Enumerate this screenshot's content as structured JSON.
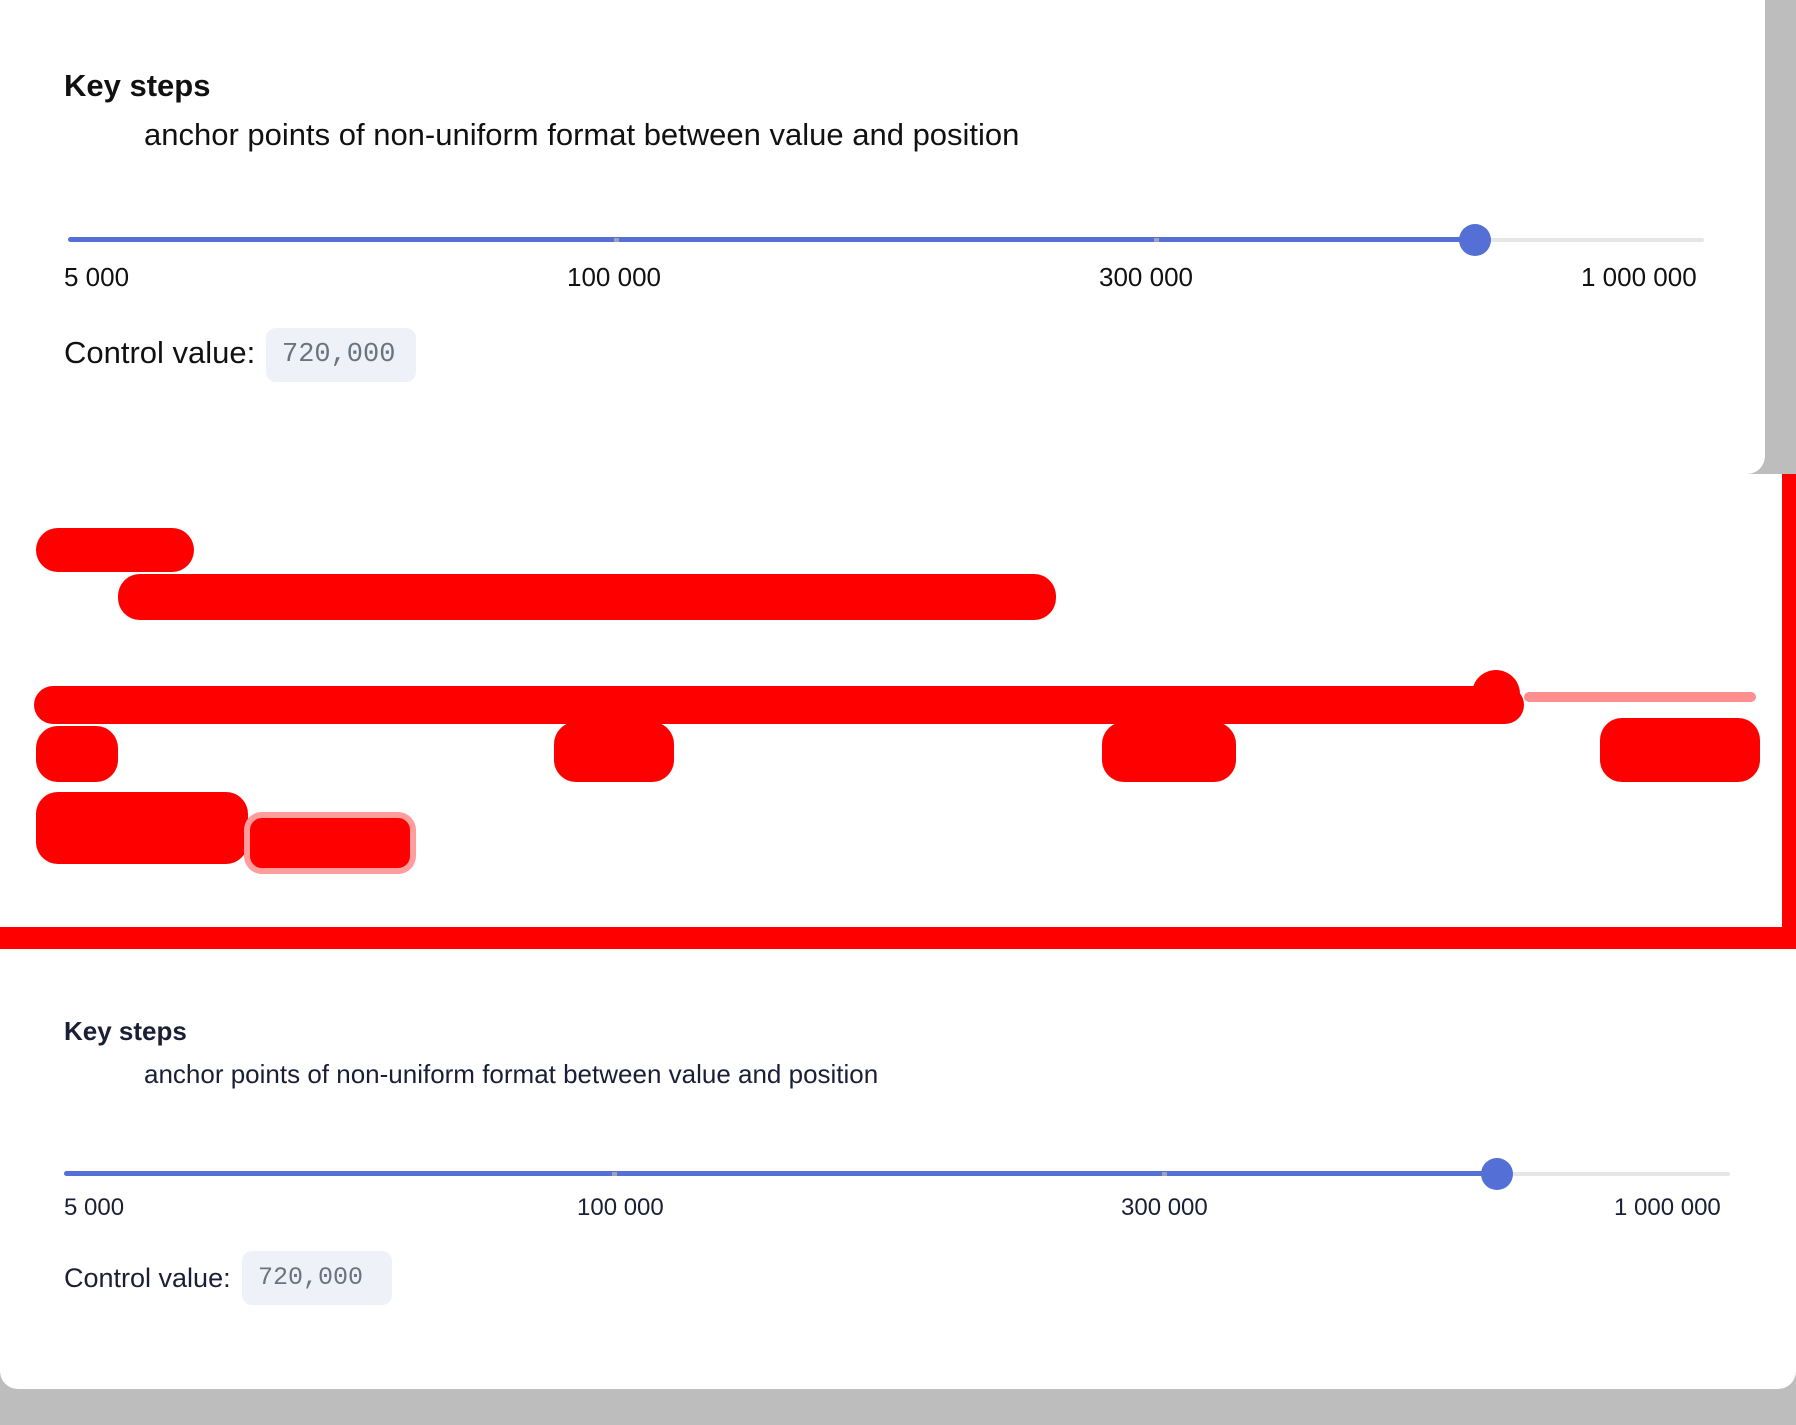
{
  "colors": {
    "accent": "#5470d6",
    "track": "#e6e6e9",
    "mark": "#9aa3b8",
    "value_bg": "#eef1f7",
    "value_text": "#6b7280",
    "highlight": "#ff0000"
  },
  "top": {
    "title": "Key steps",
    "subtitle": "anchor points of non-uniform format between value and position",
    "slider": {
      "ticks": [
        "5 000",
        "100 000",
        "300 000",
        "1 000 000"
      ],
      "fill_fraction": 0.86
    },
    "control_label": "Control value:",
    "control_value": "720,000"
  },
  "bottom": {
    "title": "Key steps",
    "subtitle": "anchor points of non-uniform format between value and position",
    "slider": {
      "ticks": [
        "5 000",
        "100 000",
        "300 000",
        "1 000 000"
      ],
      "fill_fraction": 0.86
    },
    "control_label": "Control value:",
    "control_value": "720,000"
  }
}
